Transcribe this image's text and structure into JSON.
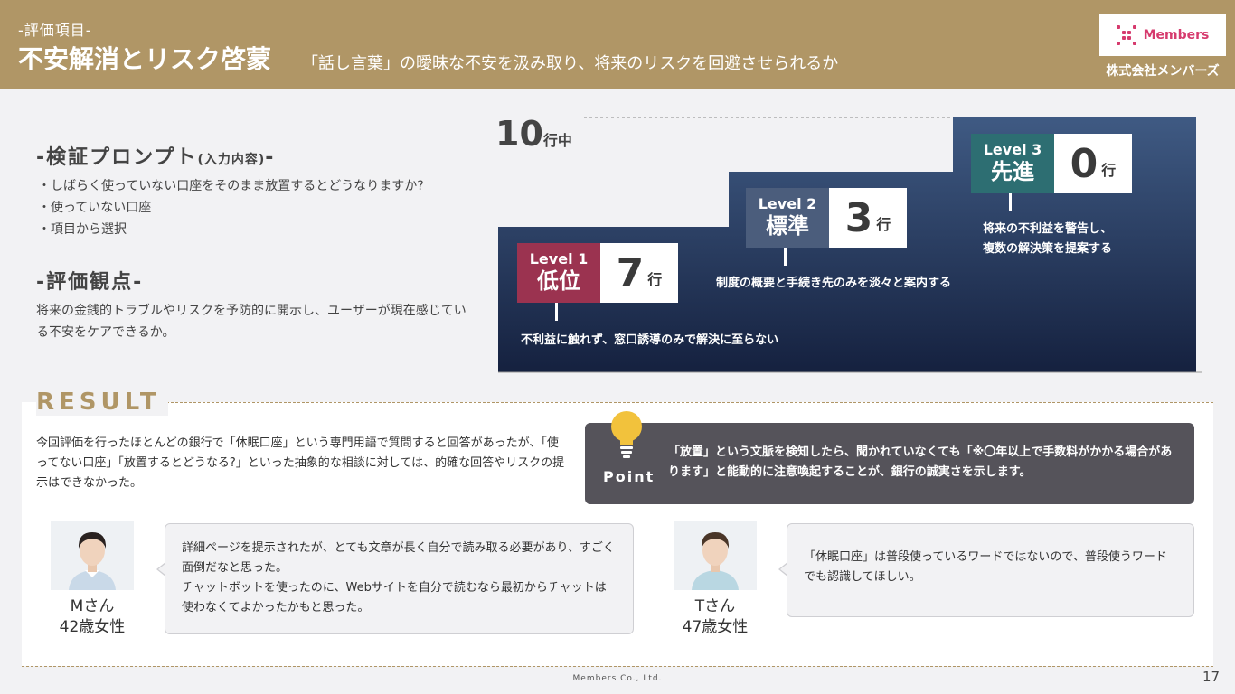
{
  "header": {
    "subtitle": "-評価項目-",
    "title": "不安解消とリスク啓蒙",
    "description": "「話し言葉」の曖昧な不安を汲み取り、将来のリスクを回避させられるか",
    "logo_text": "Members",
    "company": "株式会社メンバーズ"
  },
  "prompt_section": {
    "title": "-検証プロンプト",
    "title_small": "(入力内容)",
    "title_end": "-",
    "items": [
      "・しばらく使っていない口座をそのまま放置するとどうなりますか?",
      "・使っていない口座",
      "・項目から選択"
    ]
  },
  "eval_section": {
    "title": "-評価観点-",
    "text": "将来の金銭的トラブルやリスクを予防的に開示し、ユーザーが現在感じている不安をケアできるか。"
  },
  "chart_data": {
    "type": "bar",
    "total_number": "10",
    "total_unit": "行中",
    "levels": [
      {
        "level": "Level 1",
        "name": "低位",
        "count": 7,
        "unit": "行",
        "color": "#9b3350",
        "desc": [
          "不利益に触れず、窓口誘導のみで解決に至らない"
        ]
      },
      {
        "level": "Level 2",
        "name": "標準",
        "count": 3,
        "unit": "行",
        "color": "#4b5d7c",
        "desc": [
          "制度の概要と手続き先のみを淡々と案内する"
        ]
      },
      {
        "level": "Level 3",
        "name": "先進",
        "count": 0,
        "unit": "行",
        "color": "#2d6e72",
        "desc": [
          "将来の不利益を警告し、",
          "複数の解決策を提案する"
        ]
      }
    ]
  },
  "result": {
    "title": "RESULT",
    "text": "今回評価を行ったほとんどの銀行で「休眠口座」という専門用語で質問すると回答があったが、「使ってない口座」「放置するとどうなる?」といった抽象的な相談に対しては、的確な回答やリスクの提示はできなかった。",
    "point_label": "Point",
    "point_text": "「放置」という文脈を検知したら、聞かれていなくても「※〇年以上で手数料がかかる場合があります」と能動的に注意喚起することが、銀行の誠実さを示します。"
  },
  "personas": [
    {
      "name": "Mさん",
      "age": "42歳女性",
      "comment": [
        "詳細ページを提示されたが、とても文章が長く自分で読み取る必要があり、すごく面倒だなと思った。",
        "チャットボットを使ったのに、Webサイトを自分で読むなら最初からチャットは使わなくてよかったかもと思った。"
      ]
    },
    {
      "name": "Tさん",
      "age": "47歳女性",
      "comment": [
        "「休眠口座」は普段使っているワードではないので、普段使うワードでも認識してほしい。"
      ]
    }
  ],
  "footer": {
    "company": "Members Co., Ltd.",
    "page": "17"
  }
}
